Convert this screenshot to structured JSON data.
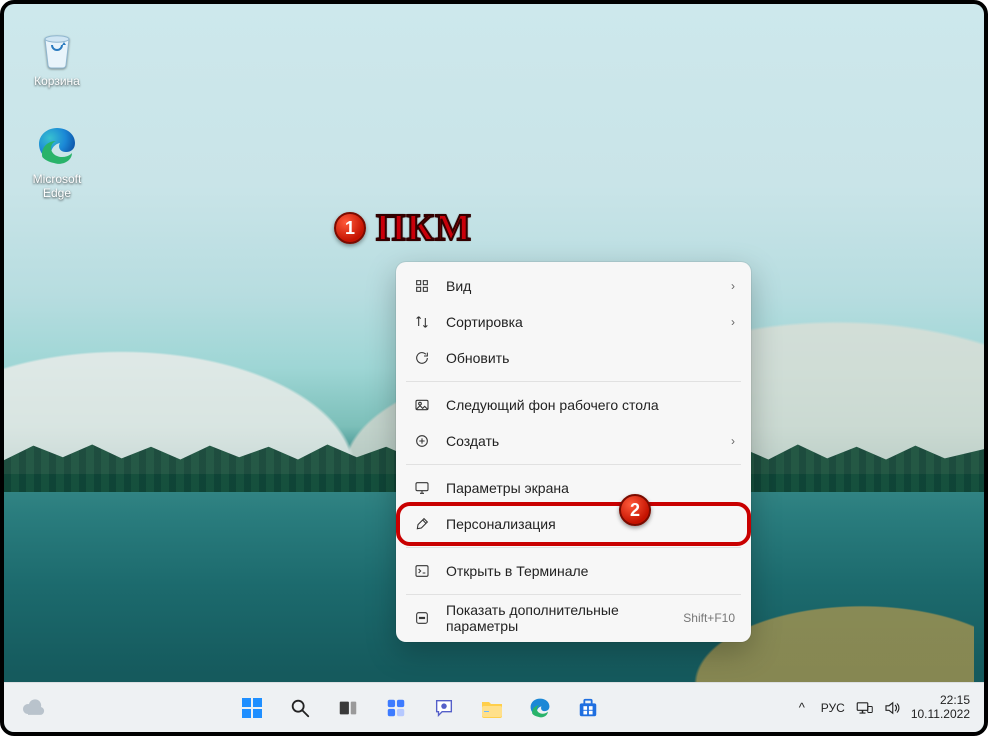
{
  "annotations": {
    "badge1": "1",
    "badge2": "2",
    "pkm_label": "ПКМ"
  },
  "desktop_icons": {
    "recycle_bin": {
      "label": "Корзина"
    },
    "edge": {
      "label": "Microsoft Edge"
    }
  },
  "context_menu": {
    "items": [
      {
        "icon": "grid-icon",
        "label": "Вид",
        "has_submenu": true
      },
      {
        "icon": "sort-icon",
        "label": "Сортировка",
        "has_submenu": true
      },
      {
        "icon": "refresh-icon",
        "label": "Обновить",
        "has_submenu": false
      },
      {
        "sep": true
      },
      {
        "icon": "next-bg-icon",
        "label": "Следующий фон рабочего стола",
        "has_submenu": false
      },
      {
        "icon": "plus-circle-icon",
        "label": "Создать",
        "has_submenu": true
      },
      {
        "sep": true
      },
      {
        "icon": "display-icon",
        "label": "Параметры экрана",
        "has_submenu": false
      },
      {
        "icon": "brush-icon",
        "label": "Персонализация",
        "has_submenu": false,
        "highlight": true
      },
      {
        "sep": true
      },
      {
        "icon": "terminal-icon",
        "label": "Открыть в Терминале",
        "has_submenu": false
      },
      {
        "sep": true
      },
      {
        "icon": "more-icon",
        "label": "Показать дополнительные параметры",
        "has_submenu": false,
        "shortcut": "Shift+F10"
      }
    ]
  },
  "taskbar": {
    "system_tray": {
      "overflow_caret": "^",
      "language": "РУС"
    },
    "clock": {
      "time": "22:15",
      "date": "10.11.2022"
    }
  }
}
